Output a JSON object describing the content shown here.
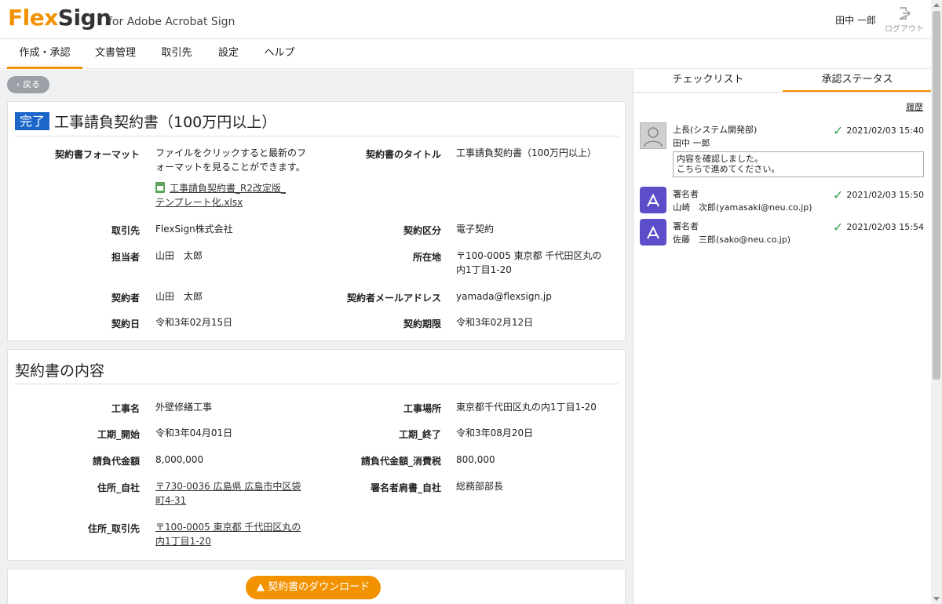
{
  "header": {
    "logo_flex": "Flex",
    "logo_sign": "Sign",
    "logo_sub": "for Adobe Acrobat Sign",
    "user_name": "田中 一郎",
    "logout_label": "ログアウト"
  },
  "nav": {
    "tabs": [
      {
        "label": "作成・承認",
        "active": true
      },
      {
        "label": "文書管理"
      },
      {
        "label": "取引先"
      },
      {
        "label": "設定"
      },
      {
        "label": "ヘルプ"
      }
    ]
  },
  "back_label": "戻る",
  "contract": {
    "status_badge": "完了",
    "title": "工事請負契約書（100万円以上）",
    "fields": {
      "format_label": "契約書フォーマット",
      "format_note": "ファイルをクリックすると最新のフォーマットを見ることができます。",
      "format_file_line1": "工事請負契約書_R2改定版_",
      "format_file_line2": "テンプレート化.xlsx",
      "doc_title_label": "契約書のタイトル",
      "doc_title_value": "工事請負契約書（100万円以上）",
      "client_label": "取引先",
      "client_value": "FlexSign株式会社",
      "contract_type_label": "契約区分",
      "contract_type_value": "電子契約",
      "person_label": "担当者",
      "person_value": "山田　太郎",
      "address_label": "所在地",
      "address_line1": "〒100-0005 東京都 千代田区丸の",
      "address_line2": "内1丁目1-20",
      "signer_label": "契約者",
      "signer_value": "山田　太郎",
      "signer_email_label": "契約者メールアドレス",
      "signer_email_value": "yamada@flexsign.jp",
      "contract_date_label": "契約日",
      "contract_date_value": "令和3年02月15日",
      "deadline_label": "契約期限",
      "deadline_value": "令和3年02月12日"
    }
  },
  "content": {
    "section_title": "契約書の内容",
    "fields": {
      "work_name_label": "工事名",
      "work_name_value": "外壁修繕工事",
      "work_place_label": "工事場所",
      "work_place_value": "東京都千代田区丸の内1丁目1-20",
      "start_label": "工期_開始",
      "start_value": "令和3年04月01日",
      "end_label": "工期_終了",
      "end_value": "令和3年08月20日",
      "amount_label": "請負代金額",
      "amount_value": "8,000,000",
      "tax_label": "請負代金額_消費税",
      "tax_value": "800,000",
      "own_address_label": "住所_自社",
      "own_address_line1": "〒730-0036 広島県 広島市中区袋",
      "own_address_line2": "町4-31",
      "own_title_label": "署名者肩書_自社",
      "own_title_value": "総務部部長",
      "client_address_label": "住所_取引先",
      "client_address_line1": "〒100-0005 東京都 千代田区丸の",
      "client_address_line2": "内1丁目1-20"
    },
    "download_label": "契約書のダウンロード"
  },
  "right_panel": {
    "tabs": [
      {
        "label": "チェックリスト"
      },
      {
        "label": "承認ステータス",
        "active": true
      }
    ],
    "history_link": "履歴",
    "entries": [
      {
        "role": "上長(システム開発部)",
        "name": "田中 一郎",
        "timestamp": "2021/02/03 15:40",
        "comment": "内容を確認しました。\nこちらで進めてください。",
        "avatar": "user-placeholder-icon"
      },
      {
        "role": "署名者",
        "name": "山崎　次郎(yamasaki@neu.co.jp)",
        "timestamp": "2021/02/03 15:50",
        "avatar": "acrobat-icon"
      },
      {
        "role": "署名者",
        "name": "佐藤　三郎(sako@neu.co.jp)",
        "timestamp": "2021/02/03 15:54",
        "avatar": "acrobat-icon"
      }
    ],
    "check_color": "#2ea44f"
  },
  "colors": {
    "accent": "#f39200",
    "badge": "#1a66c9",
    "acrobat": "#5b4ec8"
  }
}
